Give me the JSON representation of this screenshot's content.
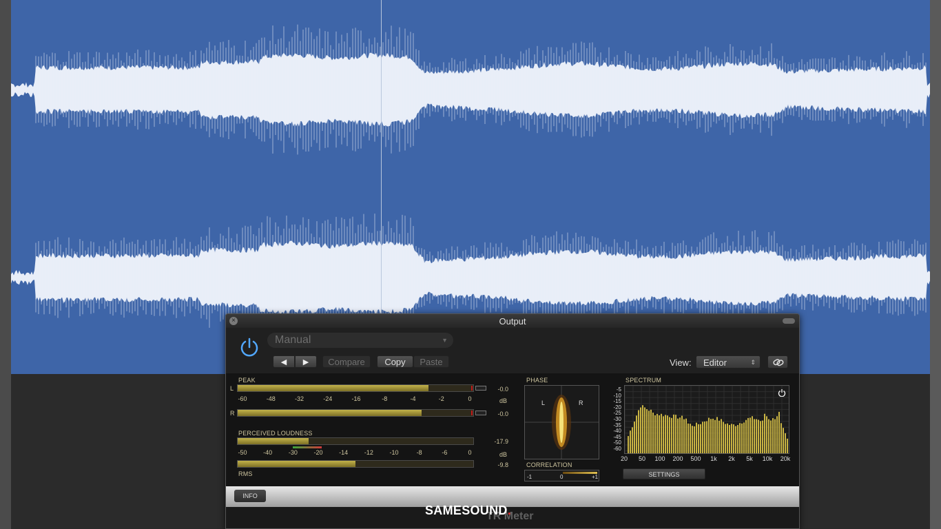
{
  "plugin": {
    "title": "Output",
    "preset": "Manual",
    "buttons": {
      "compare": "Compare",
      "copy": "Copy",
      "paste": "Paste",
      "prev": "◀",
      "next": "▶"
    },
    "view_label": "View:",
    "view_value": "Editor",
    "product_name": "TR Meter",
    "info_label": "INFO",
    "settings_label": "SETTINGS"
  },
  "peak": {
    "label": "PEAK",
    "channels": [
      {
        "label": "L",
        "value": "-0.0",
        "level": 0.81
      },
      {
        "label": "R",
        "value": "-0.0",
        "level": 0.78
      }
    ],
    "scale": [
      "-60",
      "-48",
      "-32",
      "-24",
      "-16",
      "-8",
      "-4",
      "-2",
      "0"
    ],
    "unit": "dB"
  },
  "loudness": {
    "label": "PERCEIVED LOUDNESS",
    "value": "-17.9",
    "scale": [
      "-50",
      "-40",
      "-30",
      "-20",
      "-14",
      "-12",
      "-10",
      "-8",
      "-6",
      "0"
    ],
    "unit": "dB",
    "rms_label": "RMS",
    "rms_value": "-9.8",
    "level": 0.3,
    "rms_level": 0.5
  },
  "phase": {
    "label": "PHASE",
    "left": "L",
    "right": "R"
  },
  "correlation": {
    "label": "CORRELATION",
    "scale": [
      "-1",
      "0",
      "+1"
    ]
  },
  "spectrum": {
    "label": "SPECTRUM",
    "y_ticks": [
      "-5",
      "-10",
      "-15",
      "-20",
      "-25",
      "-30",
      "-35",
      "-40",
      "-45",
      "-50",
      "-60"
    ],
    "x_ticks": [
      "20",
      "50",
      "100",
      "200",
      "500",
      "1k",
      "2k",
      "5k",
      "10k",
      "20k"
    ]
  },
  "watermark": {
    "text": "SAMESOUND",
    "dot": "."
  },
  "colors": {
    "waveform_bg": "#3e65a8",
    "waveform": "#e9eef8",
    "meter": "#c2b24a"
  }
}
